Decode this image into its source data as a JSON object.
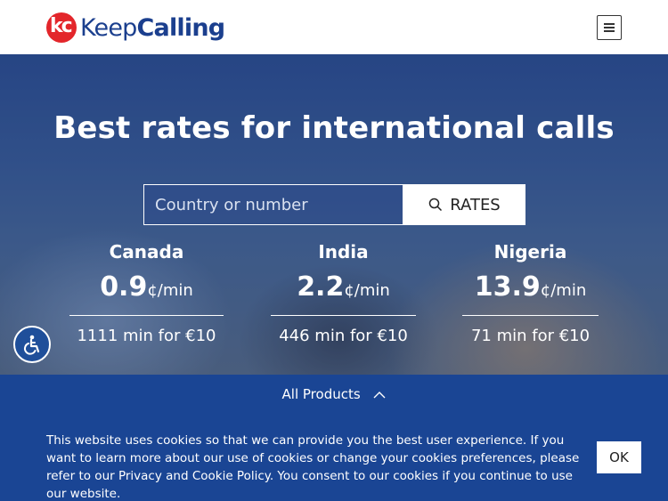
{
  "header": {
    "logo_light": "Keep",
    "logo_bold": "Calling",
    "logo_mark": "kc"
  },
  "hero": {
    "title": "Best rates for international calls",
    "search_placeholder": "Country or number",
    "rates_button": "RATES"
  },
  "rates": [
    {
      "country": "Canada",
      "price": "0.9",
      "unit": "¢/min",
      "minutes": "1111 min for €10"
    },
    {
      "country": "India",
      "price": "2.2",
      "unit": "¢/min",
      "minutes": "446 min for €10"
    },
    {
      "country": "Nigeria",
      "price": "13.9",
      "unit": "¢/min",
      "minutes": "71 min for €10"
    }
  ],
  "bottom": {
    "all_products": "All Products",
    "cookie_text": "This website uses cookies so that we can provide you the best user experience. If you want to learn more about our use of cookies or change your cookies preferences, please refer to our Privacy and Cookie Policy. You consent to our cookies if you continue to use our website.",
    "ok_button": "OK"
  },
  "icons": {
    "menu": "hamburger-menu-icon",
    "search": "search-icon",
    "accessibility": "accessibility-icon",
    "chevron": "chevron-up-icon"
  },
  "colors": {
    "brand_blue": "#1b3f8e",
    "brand_red": "#e3262b",
    "footer_blue": "#1a4594"
  }
}
